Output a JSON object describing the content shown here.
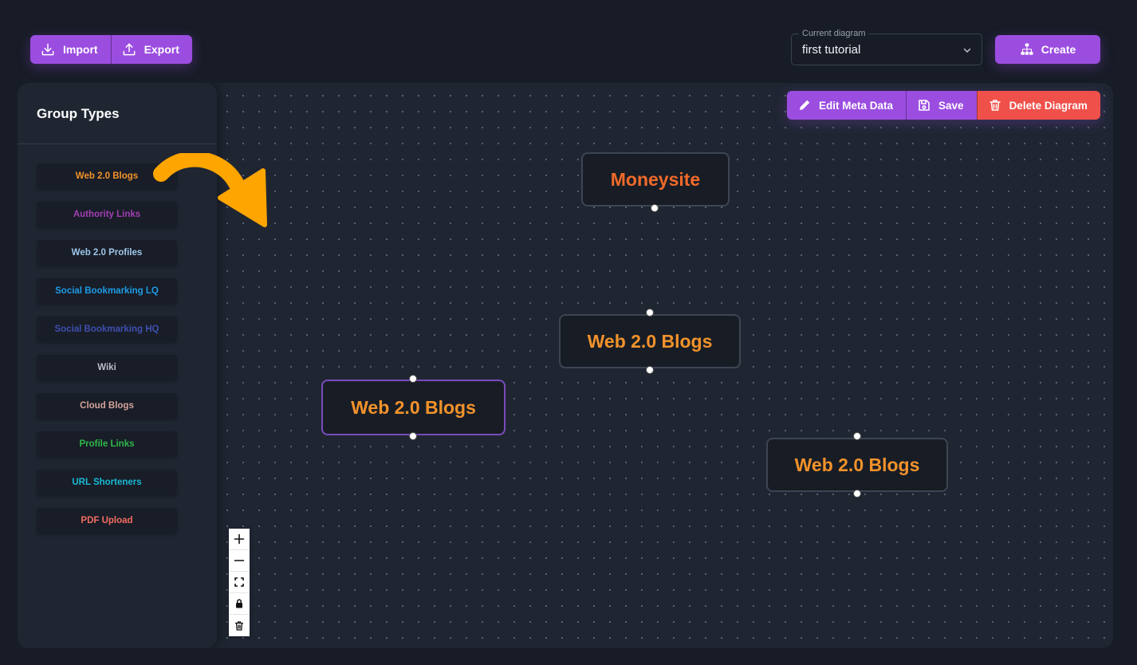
{
  "header": {
    "import_label": "Import",
    "export_label": "Export",
    "diagram_select_legend": "Current diagram",
    "diagram_select_value": "first tutorial",
    "create_label": "Create"
  },
  "sidebar": {
    "title": "Group Types",
    "items": [
      {
        "label": "Web 2.0 Blogs",
        "color": "#f2922b"
      },
      {
        "label": "Authority Links",
        "color": "#a13fb3"
      },
      {
        "label": "Web 2.0 Profiles",
        "color": "#9fc6ea"
      },
      {
        "label": "Social Bookmarking LQ",
        "color": "#1f9be6"
      },
      {
        "label": "Social Bookmarking HQ",
        "color": "#3f4fb0"
      },
      {
        "label": "Wiki",
        "color": "#b9bec8"
      },
      {
        "label": "Cloud Blogs",
        "color": "#d4a39a"
      },
      {
        "label": "Profile Links",
        "color": "#2fb84a"
      },
      {
        "label": "URL Shorteners",
        "color": "#18b9d3"
      },
      {
        "label": "PDF Upload",
        "color": "#f06d5f"
      }
    ]
  },
  "toolbar": {
    "edit_meta_label": "Edit Meta Data",
    "save_label": "Save",
    "delete_label": "Delete Diagram"
  },
  "nodes": [
    {
      "label": "Moneysite",
      "color": "#f06a2a"
    },
    {
      "label": "Web 2.0 Blogs",
      "color": "#f2922b"
    },
    {
      "label": "Web 2.0 Blogs",
      "color": "#f2922b"
    },
    {
      "label": "Web 2.0 Blogs",
      "color": "#f2922b"
    }
  ],
  "controls": [
    "zoom-in-icon",
    "zoom-out-icon",
    "fit-view-icon",
    "lock-icon",
    "trash-icon"
  ],
  "colors": {
    "accent": "#9b4de0",
    "danger": "#f0504a",
    "arrow": "#ffa500"
  }
}
